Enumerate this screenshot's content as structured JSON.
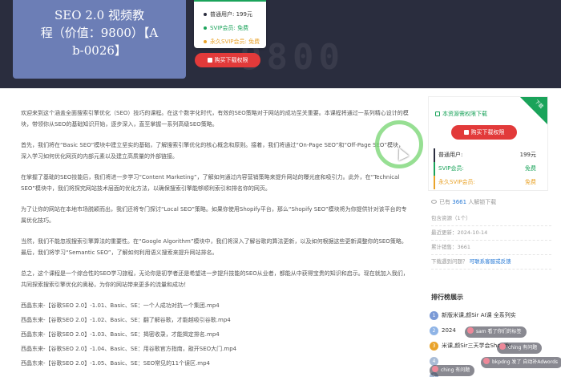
{
  "hero": {
    "cover_lines": [
      "SEO 2.0 视频教",
      "程（价值：9800）【A",
      "b-0026】"
    ],
    "bg_text": "9800"
  },
  "price_card": {
    "normal_label": "普通用户:",
    "normal_price": "199元",
    "svip_label": "SVIP会员:",
    "svip_price": "免费",
    "forever_label": "永久SVIP会员:",
    "forever_price": "免费",
    "buy_label": "购买下载权限"
  },
  "article": {
    "paragraphs": [
      "欢迎来到这个涵盖全面搜索引擎优化（SEO）技巧的课程。在这个数字化时代，有效的SEO策略对于网站的成功至关重要。本课程将通过一系列精心设计的模块，带领你从SEO的基础知识开始，逐步深入，直至掌握一系列高级SEO策略。",
      "首先，我们将在“Basic SEO”模块中建立坚实的基础，了解搜索引擎优化的核心概念和原则。接着，我们将通过“On-Page SEO”和“Off-Page SEO”模块，深入学习如何优化网页的内部元素以及建立高质量的外部链接。",
      "在掌握了基础的SEO技能后，我们将进一步学习“Content Marketing”，了解如何通过内容营销策略来提升网站的曝光度和吸引力。此外，在“Technical SEO”模块中，我们将探究网站技术层面的优化方法，以确保搜索引擎能够顺利索引和排名你的网页。",
      "为了让你的网站在本地市场脱颖而出，我们还将专门探讨“Local SEO”策略。如果你使用Shopify平台，那么“Shopify SEO”模块将为你提供针对该平台的专属优化技巧。",
      "当然，我们不能忽视搜索引擎算法的重要性。在“Google Algorithm”模块中，我们将深入了解谷歌的算法更新，以及如何根据这些更新调整你的SEO策略。最后，我们将学习“Semantic SEO”，了解如何利用语义搜索来提升网站排名。",
      "总之，这个课程是一个综合性的SEO学习旅程，无论你是初学者还是希望进一步提升技能的SEO从业者，都能从中获得宝贵的知识和启示。现在就加入我们，共同探索搜索引擎优化的奥秘，为你的网站带来更多的流量和成功！"
    ],
    "lessons": [
      "西晶东来-【谷歌SEO 2.0】-1.01、Basic、SE：一个人成功对抗一个集团.mp4",
      "西晶东来-【谷歌SEO 2.0】-1.02、Basic、SE：翻了解谷歌，才能越吸引谷歌.mp4",
      "西晶东来-【谷歌SEO 2.0】-1.03、Basic、SE：揭密收录，才能揭定排名.mp4",
      "西晶东来-【谷歌SEO 2.0】-1.04、Basic、SE：用谷歌官方指南，敲开SEO大门.mp4",
      "西晶东来-【谷歌SEO 2.0】-1.05、Basic、SE：SEO常见的11个误区.mp4"
    ]
  },
  "sidebar": {
    "ribbon": "下载",
    "perm_title": "本资源需权限下载",
    "buy_label": "购买下载权限",
    "prices": [
      {
        "label": "普通用户:",
        "value": "199元"
      },
      {
        "label": "SVIP会员:",
        "value": "免费"
      },
      {
        "label": "永久SVIP会员:",
        "value": "免费"
      }
    ],
    "people_prefix": "已有",
    "people_count": "3661",
    "people_suffix": "人解锁下载",
    "meta": {
      "resources": "包含资源（1个）",
      "updated": "最近更新：2024-10-14",
      "downloads": "累计销售：3661",
      "problem": "下载遇到问题？",
      "contact": "可联系客服或反馈"
    },
    "rank_title": "排行榜展示",
    "rank_items": [
      {
        "num": "1",
        "text": "新版米课,颜Sir AI课 全系列实",
        "color": "#7b9ad6"
      },
      {
        "num": "2",
        "text": "2024",
        "color": "#8fb4e6"
      },
      {
        "num": "3",
        "text": "米课,颜Sir三天学会Shopify",
        "color": "#e9a32a"
      },
      {
        "num": "4",
        "text": "",
        "color": "#a9bcd6"
      },
      {
        "num": "5",
        "text": "",
        "color": "#a9bcd6"
      }
    ]
  },
  "overlays": {
    "danmaku": [
      "sam 看了你们的标签",
      "ching 有问题",
      "bkpdng 发了 自动补Adwords",
      "ching 有问题",
      "Adwords"
    ]
  },
  "colors": {
    "hero_bg": "#2a2d3e",
    "cover_bg": "#6c7eb6",
    "accent_red": "#e23a3a",
    "accent_green": "#1aa35a",
    "accent_gold": "#e9a32a"
  }
}
